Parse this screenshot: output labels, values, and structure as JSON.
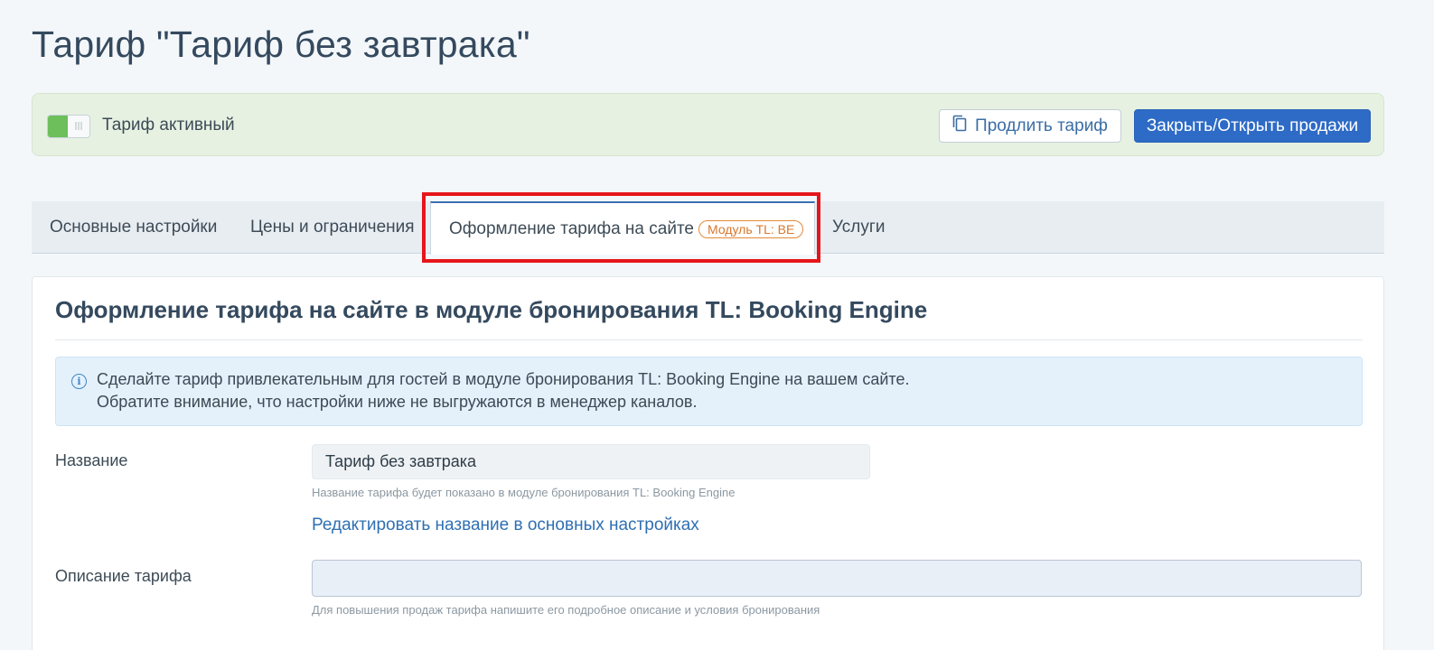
{
  "page": {
    "title": "Тариф \"Тариф без завтрака\""
  },
  "status_bar": {
    "toggle_state": "on",
    "toggle_glyph": "|||",
    "label": "Тариф активный",
    "extend_button_label": "Продлить тариф",
    "extend_button_icon": "copy-icon",
    "sales_button_label": "Закрыть/Открыть продажи"
  },
  "tabs": [
    {
      "label": "Основные настройки",
      "active": false
    },
    {
      "label": "Цены и ограничения",
      "active": false
    },
    {
      "label": "Оформление тарифа на сайте",
      "active": true,
      "badge": "Модуль TL: BE"
    },
    {
      "label": "Услуги",
      "active": false
    }
  ],
  "section": {
    "title": "Оформление тарифа на сайте в модуле бронирования TL: Booking Engine",
    "info_icon_glyph": "i",
    "info_line_1": "Сделайте тариф привлекательным для гостей в модуле бронирования TL: Booking Engine на вашем сайте.",
    "info_line_2": "Обратите внимание, что настройки ниже не выгружаются в менеджер каналов."
  },
  "form": {
    "name_label": "Название",
    "name_value": "Тариф без завтрака",
    "name_hint": "Название тарифа будет показано в модуле бронирования TL: Booking Engine",
    "edit_name_link": "Редактировать название в основных настройках",
    "description_label": "Описание тарифа",
    "description_value": "",
    "description_hint": "Для повышения продаж тарифа напишите его подробное описание и условия бронирования"
  },
  "colors": {
    "primary": "#2e6bc6",
    "active_toggle": "#6cbf5a",
    "status_bar_bg": "#e6f1e2",
    "badge": "#e38a3a",
    "highlight": "#e5161b",
    "link": "#2f6fb3",
    "info_bg": "#e4f1fb"
  }
}
